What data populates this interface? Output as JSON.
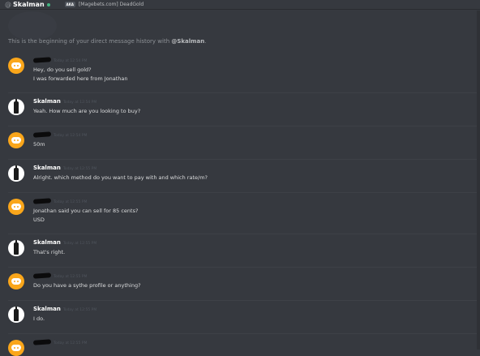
{
  "header": {
    "username": "Skalman",
    "aka_badge": "AKA",
    "aka_text": "[Magebets.com] DeadGold"
  },
  "intro": {
    "prefix": "This is the beginning of your direct message history with ",
    "handle": "@Skalman",
    "suffix": "."
  },
  "colors": {
    "background": "#36393f",
    "online": "#43b581",
    "discord_avatar": "#faa61a"
  },
  "messages": [
    {
      "author": "",
      "avatar": "discord-default-avatar",
      "timestamp": "Today at 12:54 PM",
      "lines": [
        "Hey, do you sell gold?",
        "I was forwarded here from Jonathan"
      ]
    },
    {
      "author": "Skalman",
      "avatar": "bottle-avatar",
      "timestamp": "Today at 12:54 PM",
      "lines": [
        "Yeah. How much are you looking to buy?"
      ]
    },
    {
      "author": "",
      "avatar": "discord-default-avatar",
      "timestamp": "Today at 12:54 PM",
      "lines": [
        "50m"
      ]
    },
    {
      "author": "Skalman",
      "avatar": "bottle-avatar",
      "timestamp": "Today at 12:55 PM",
      "lines": [
        "Alright. which method do you want to pay with and which rate/m?"
      ]
    },
    {
      "author": "",
      "avatar": "discord-default-avatar",
      "timestamp": "Today at 12:55 PM",
      "lines": [
        "Jonathan said you can sell for 85 cents?",
        "USD"
      ]
    },
    {
      "author": "Skalman",
      "avatar": "bottle-avatar",
      "timestamp": "Today at 12:55 PM",
      "lines": [
        "That's right."
      ]
    },
    {
      "author": "",
      "avatar": "discord-default-avatar",
      "timestamp": "Today at 12:55 PM",
      "lines": [
        "Do you have a sythe profile or anything?"
      ]
    },
    {
      "author": "Skalman",
      "avatar": "bottle-avatar",
      "timestamp": "Today at 12:55 PM",
      "lines": [
        "I do."
      ]
    },
    {
      "author": "",
      "avatar": "discord-default-avatar",
      "timestamp": "Today at 12:55 PM",
      "lines": []
    }
  ]
}
